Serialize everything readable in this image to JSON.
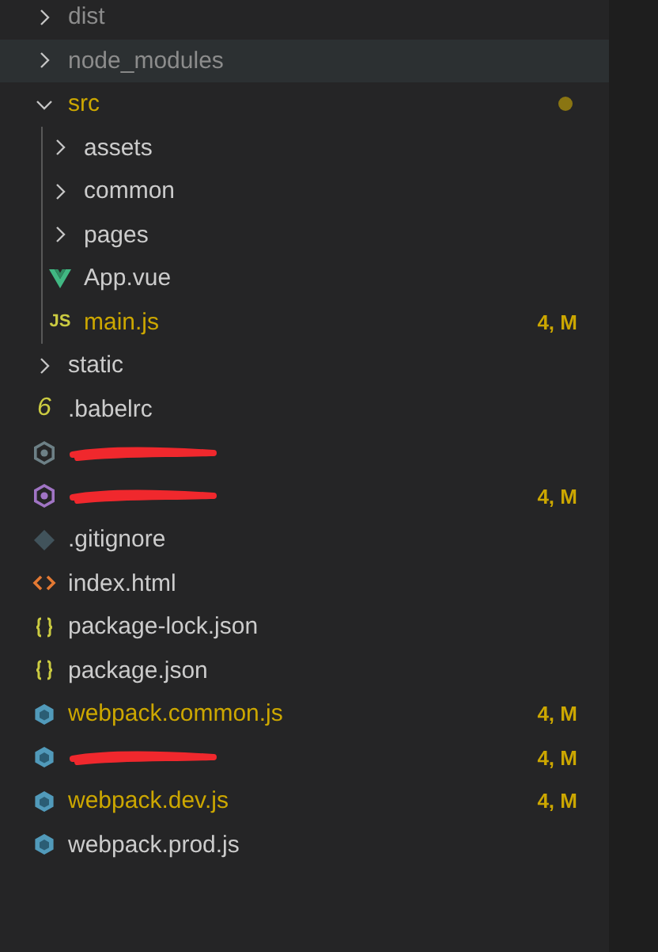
{
  "explorer": {
    "items": [
      {
        "kind": "folder",
        "name": "dist",
        "expanded": false,
        "color": "#8c8c8c",
        "hovered": false
      },
      {
        "kind": "folder",
        "name": "node_modules",
        "expanded": false,
        "color": "#8c8c8c",
        "hovered": true
      },
      {
        "kind": "folder",
        "name": "src",
        "expanded": true,
        "color": "#cca700",
        "hovered": false,
        "dot": true,
        "children": [
          {
            "kind": "folder",
            "name": "assets",
            "expanded": false,
            "color": "#cccccc",
            "hovered": false
          },
          {
            "kind": "folder",
            "name": "common",
            "expanded": false,
            "color": "#cccccc",
            "hovered": false
          },
          {
            "kind": "folder",
            "name": "pages",
            "expanded": false,
            "color": "#cccccc",
            "hovered": false
          },
          {
            "kind": "vue",
            "name": "App.vue",
            "color": "#cccccc",
            "hovered": false,
            "redacted": false
          },
          {
            "kind": "js",
            "icon_text": "JS",
            "name": "main.js",
            "color": "#cca700",
            "hovered": false,
            "redacted": false,
            "badge": "4, M"
          }
        ]
      },
      {
        "kind": "folder",
        "name": "static",
        "expanded": false,
        "color": "#cccccc",
        "hovered": false
      },
      {
        "kind": "babel",
        "icon_text": "6",
        "name": ".babelrc",
        "color": "#cccccc",
        "hovered": false,
        "redacted": false
      },
      {
        "kind": "eslint",
        "hovered": false,
        "redacted": true
      },
      {
        "kind": "eslintrc",
        "color": "#cca700",
        "hovered": false,
        "redacted": true,
        "badge": "4, M"
      },
      {
        "kind": "git",
        "name": ".gitignore",
        "color": "#cccccc",
        "hovered": false,
        "redacted": false
      },
      {
        "kind": "html",
        "name": "index.html",
        "color": "#cccccc",
        "hovered": false,
        "redacted": false
      },
      {
        "kind": "json",
        "name": "package-lock.json",
        "color": "#cccccc",
        "hovered": false,
        "redacted": false
      },
      {
        "kind": "json",
        "name": "package.json",
        "color": "#cccccc",
        "hovered": false,
        "redacted": false
      },
      {
        "kind": "webpack",
        "name": "webpack.common.js",
        "color": "#cca700",
        "hovered": false,
        "redacted": false,
        "badge": "4, M"
      },
      {
        "kind": "webpack",
        "color": "#cca700",
        "hovered": false,
        "redacted": true,
        "badge": "4, M"
      },
      {
        "kind": "webpack",
        "name": "webpack.dev.js",
        "color": "#cca700",
        "hovered": false,
        "redacted": false,
        "badge": "4, M"
      },
      {
        "kind": "webpack",
        "name": "webpack.prod.js",
        "color": "#cccccc",
        "hovered": false,
        "redacted": false
      }
    ]
  }
}
